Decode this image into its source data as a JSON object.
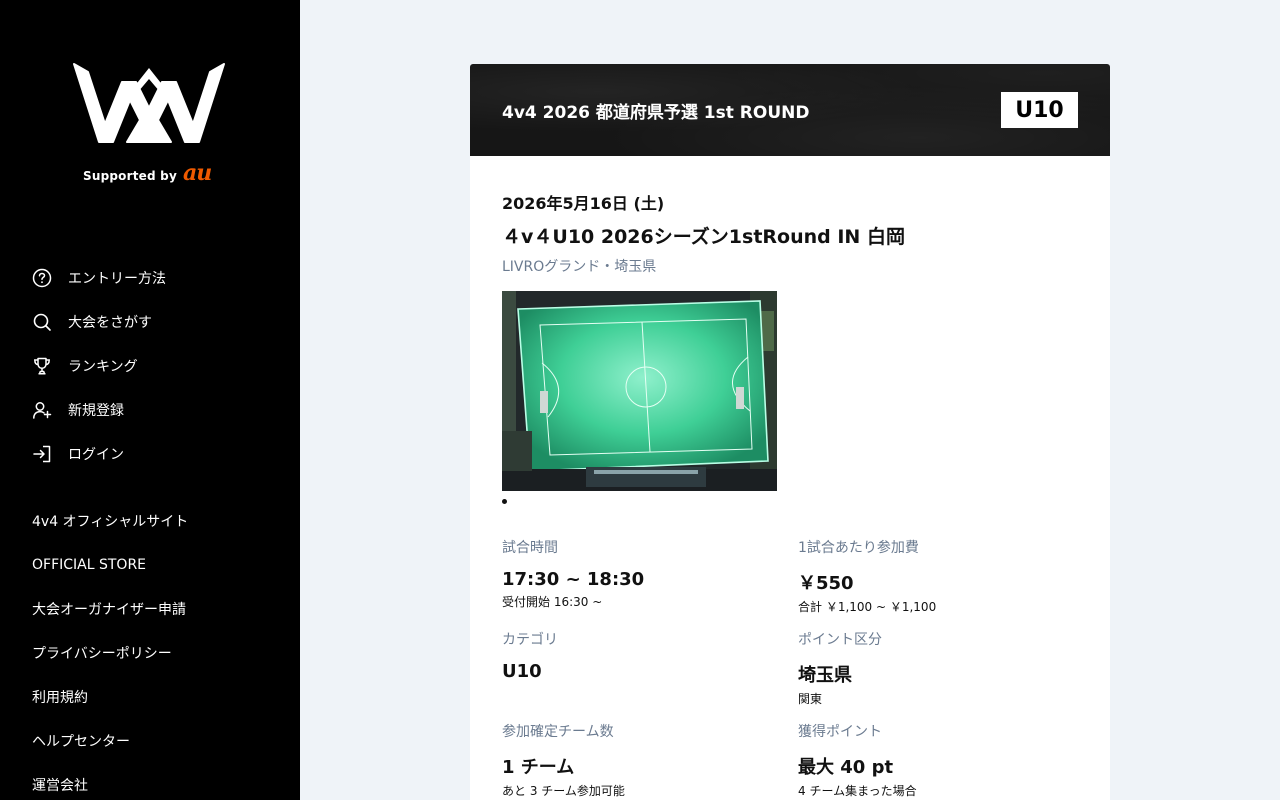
{
  "sidebar": {
    "brand": {
      "supported_text": "Supported by",
      "au_text": "au"
    },
    "nav": [
      {
        "label": "エントリー方法",
        "icon": "help-circle-icon"
      },
      {
        "label": "大会をさがす",
        "icon": "search-icon"
      },
      {
        "label": "ランキング",
        "icon": "trophy-icon"
      },
      {
        "label": "新規登録",
        "icon": "user-plus-icon"
      },
      {
        "label": "ログイン",
        "icon": "login-icon"
      }
    ],
    "links": [
      "4v4 オフィシャルサイト",
      "OFFICIAL STORE",
      "大会オーガナイザー申請",
      "プライバシーポリシー",
      "利用規約",
      "ヘルプセンター",
      "運営会社"
    ]
  },
  "event": {
    "header_title": "4v4 2026 都道府県予選 1st ROUND",
    "category_badge": "U10",
    "date": "2026年5月16日 (土)",
    "name": "４v４U10 2026シーズン1stRound IN 白岡",
    "venue": "LIVROグランド・埼玉県"
  },
  "details": {
    "time": {
      "label": "試合時間",
      "value": "17:30 ~ 18:30",
      "sub": "受付開始 16:30 ~"
    },
    "fee": {
      "label": "1試合あたり参加費",
      "value": "￥550",
      "sub": "合計 ￥1,100 ~ ￥1,100"
    },
    "category": {
      "label": "カテゴリ",
      "value": "U10"
    },
    "point_area": {
      "label": "ポイント区分",
      "value": "埼玉県",
      "sub": "関東"
    },
    "teams": {
      "label": "参加確定チーム数",
      "value": "1 チーム",
      "sub": "あと 3 チーム参加可能"
    },
    "points": {
      "label": "獲得ポイント",
      "value": "最大 40 pt",
      "sub": "4 チーム集まった場合"
    }
  },
  "colors": {
    "sidebar_bg": "#000000",
    "page_bg": "#eff3f8",
    "accent_au": "#f05a00",
    "muted_label": "#6b7b90"
  }
}
